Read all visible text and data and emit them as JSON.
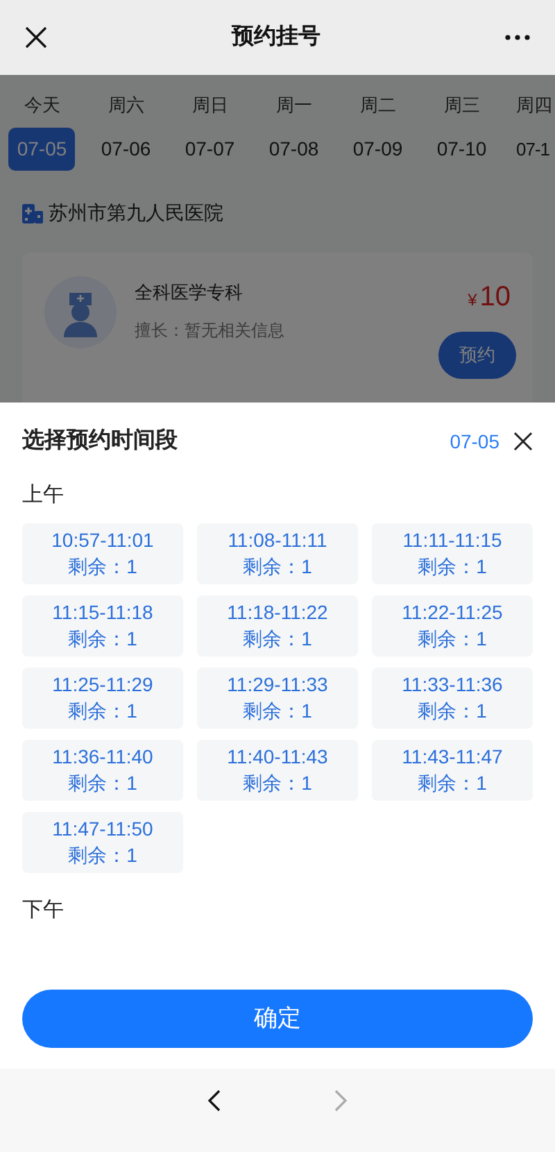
{
  "nav": {
    "title": "预约挂号"
  },
  "dates": [
    {
      "weekday": "今天",
      "date": "07-05",
      "selected": true
    },
    {
      "weekday": "周六",
      "date": "07-06",
      "selected": false
    },
    {
      "weekday": "周日",
      "date": "07-07",
      "selected": false
    },
    {
      "weekday": "周一",
      "date": "07-08",
      "selected": false
    },
    {
      "weekday": "周二",
      "date": "07-09",
      "selected": false
    },
    {
      "weekday": "周三",
      "date": "07-10",
      "selected": false
    },
    {
      "weekday": "周四",
      "date": "07-1",
      "selected": false
    }
  ],
  "hospital": "苏州市第九人民医院",
  "doctor": {
    "name": "全科医学专科",
    "specialty": "擅长：暂无相关信息",
    "currency": "¥",
    "price": "10",
    "book_button": "预约"
  },
  "sheet": {
    "title": "选择预约时间段",
    "date": "07-05",
    "sections": [
      {
        "label": "上午",
        "slots": [
          {
            "time": "10:57-11:01",
            "remaining": "剩余：1"
          },
          {
            "time": "11:08-11:11",
            "remaining": "剩余：1"
          },
          {
            "time": "11:11-11:15",
            "remaining": "剩余：1"
          },
          {
            "time": "11:15-11:18",
            "remaining": "剩余：1"
          },
          {
            "time": "11:18-11:22",
            "remaining": "剩余：1"
          },
          {
            "time": "11:22-11:25",
            "remaining": "剩余：1"
          },
          {
            "time": "11:25-11:29",
            "remaining": "剩余：1"
          },
          {
            "time": "11:29-11:33",
            "remaining": "剩余：1"
          },
          {
            "time": "11:33-11:36",
            "remaining": "剩余：1"
          },
          {
            "time": "11:36-11:40",
            "remaining": "剩余：1"
          },
          {
            "time": "11:40-11:43",
            "remaining": "剩余：1"
          },
          {
            "time": "11:43-11:47",
            "remaining": "剩余：1"
          },
          {
            "time": "11:47-11:50",
            "remaining": "剩余：1"
          }
        ]
      },
      {
        "label": "下午"
      }
    ],
    "confirm_button": "确定"
  }
}
